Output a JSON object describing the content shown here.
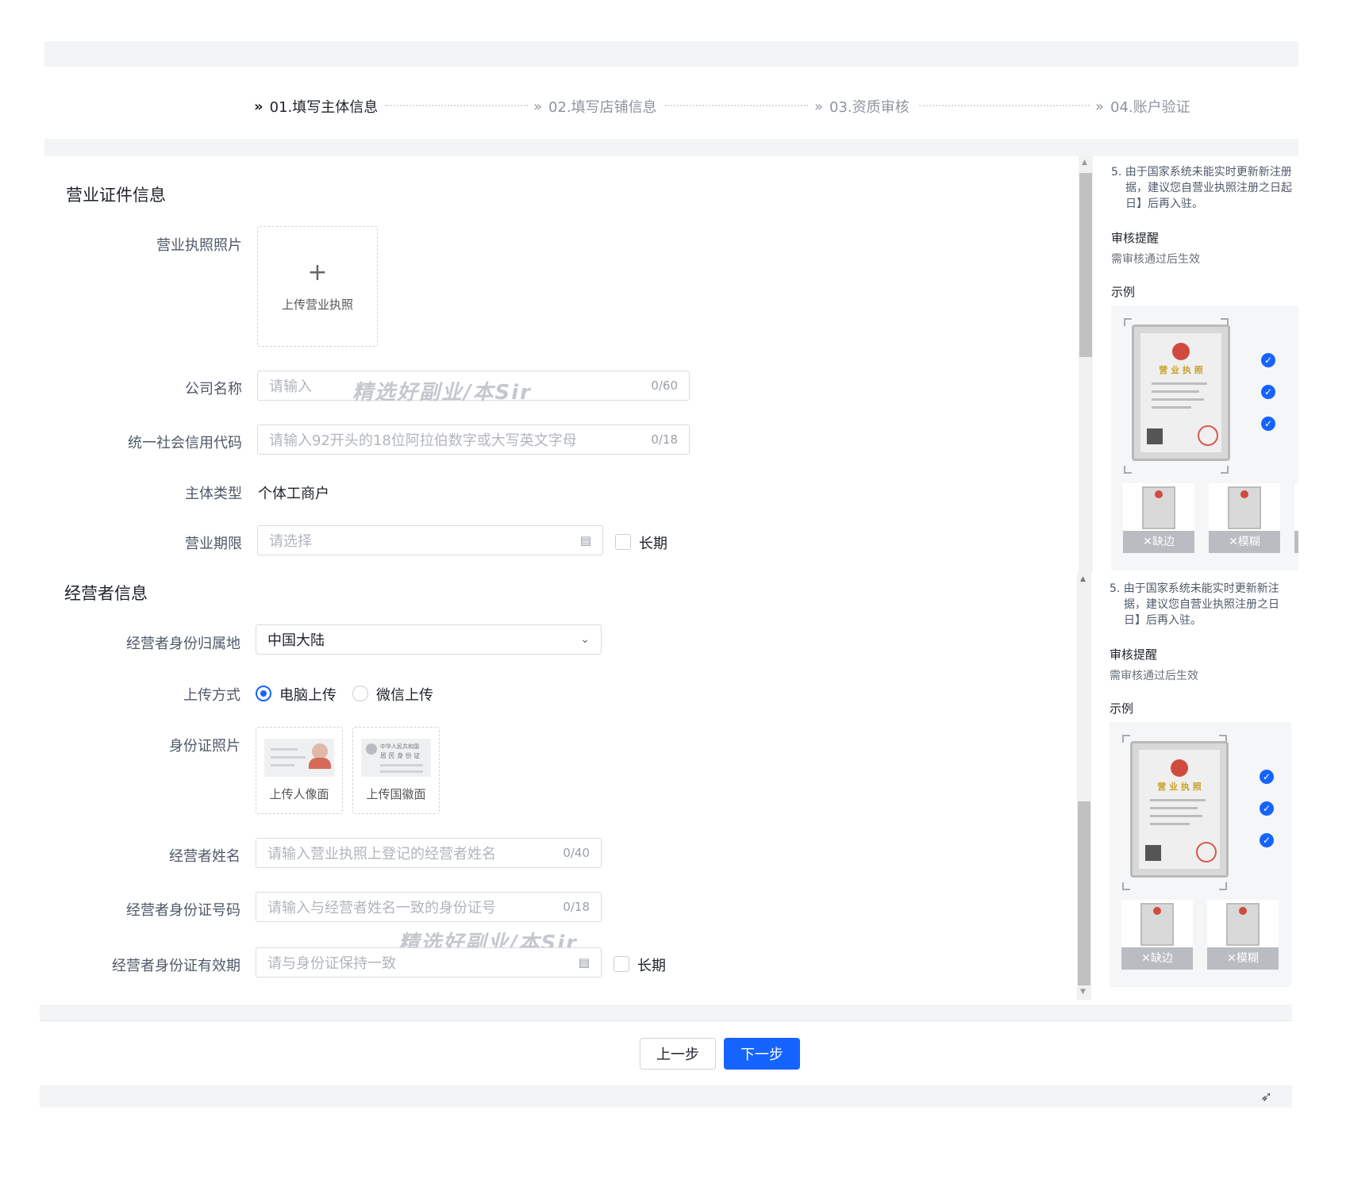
{
  "steps": [
    {
      "label": "01.填写主体信息",
      "active": true
    },
    {
      "label": "02.填写店铺信息",
      "active": false
    },
    {
      "label": "03.资质审核",
      "active": false
    },
    {
      "label": "04.账户验证",
      "active": false
    }
  ],
  "business_section": {
    "title": "营业证件信息",
    "license_photo_label": "营业执照照片",
    "upload_license_text": "上传营业执照",
    "company_name_label": "公司名称",
    "company_name_placeholder": "请输入",
    "company_name_count": "0/60",
    "credit_code_label": "统一社会信用代码",
    "credit_code_placeholder": "请输入92开头的18位阿拉伯数字或大写英文字母",
    "credit_code_count": "0/18",
    "entity_type_label": "主体类型",
    "entity_type_value": "个体工商户",
    "period_label": "营业期限",
    "period_placeholder": "请选择",
    "long_term_label": "长期"
  },
  "operator_section": {
    "title": "经营者信息",
    "region_label": "经营者身份归属地",
    "region_value": "中国大陆",
    "upload_method_label": "上传方式",
    "upload_pc": "电脑上传",
    "upload_wechat": "微信上传",
    "id_photo_label": "身份证照片",
    "id_front_text": "上传人像面",
    "id_back_text": "上传国徽面",
    "id_back_card_title": "中华人民共和国",
    "id_back_card_sub": "居 民 身 份 证",
    "name_label": "经营者姓名",
    "name_placeholder": "请输入营业执照上登记的经营者姓名",
    "name_count": "0/40",
    "id_number_label": "经营者身份证号码",
    "id_number_placeholder": "请输入与经营者姓名一致的身份证号",
    "id_number_count": "0/18",
    "id_valid_label": "经营者身份证有效期",
    "id_valid_placeholder": "请与身份证保持一致",
    "long_term_label": "长期"
  },
  "right_panel_top": {
    "tip_line1": "5. 由于国家系统未能实时更新新注册",
    "tip_line2": "据，建议您自营业执照注册之日起",
    "tip_line3": "日】后再入驻。",
    "review_title": "审核提醒",
    "review_sub": "需审核通过后生效",
    "example_title": "示例",
    "license_title": "营 业 执 照",
    "bad1": "✕缺边",
    "bad2": "✕模糊"
  },
  "right_panel_bottom": {
    "tip_line1": "5. 由于国家系统未能实时更新新注",
    "tip_line2": "据，建议您自营业执照注册之日",
    "tip_line3": "日】后再入驻。",
    "review_title": "审核提醒",
    "review_sub": "需审核通过后生效",
    "example_title": "示例",
    "license_title": "营 业 执 照",
    "bad1": "✕缺边",
    "bad2": "✕模糊"
  },
  "watermark": "精选好副业/本Sir",
  "buttons": {
    "prev": "上一步",
    "next": "下一步"
  },
  "colors": {
    "primary": "#1664ff",
    "bg_gray": "#f3f4f6"
  }
}
